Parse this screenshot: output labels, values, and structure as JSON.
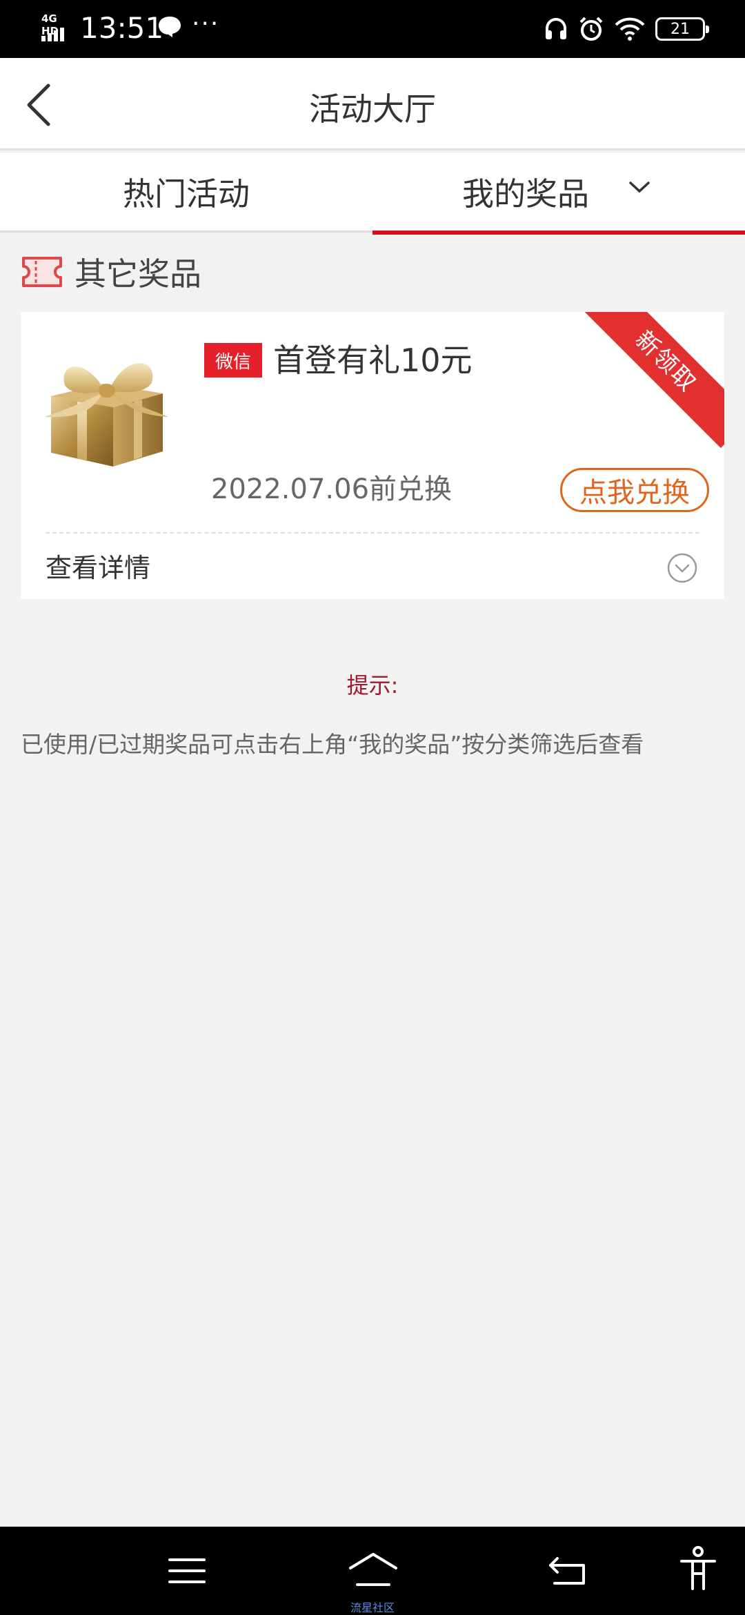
{
  "status_bar": {
    "network": "4G HD",
    "time": "13:51",
    "more": "···",
    "battery": "21"
  },
  "header": {
    "title": "活动大厅"
  },
  "tabs": [
    {
      "label": "热门活动",
      "active": false
    },
    {
      "label": "我的奖品",
      "active": true
    }
  ],
  "section": {
    "title": "其它奖品"
  },
  "prize": {
    "source_badge": "微信",
    "title": "首登有礼10元",
    "ribbon": "新领取",
    "expire": "2022.07.06前兑换",
    "redeem_label": "点我兑换",
    "details_label": "查看详情"
  },
  "tip": {
    "label": "提示:",
    "text": "已使用/已过期奖品可点击右上角“我的奖品”按分类筛选后查看"
  },
  "nav": {
    "home_label": "流星社区"
  },
  "colors": {
    "accent_red": "#d4101f",
    "redeem_orange": "#e0651c",
    "badge_red": "#e5202b",
    "tip_red": "#a01830"
  }
}
